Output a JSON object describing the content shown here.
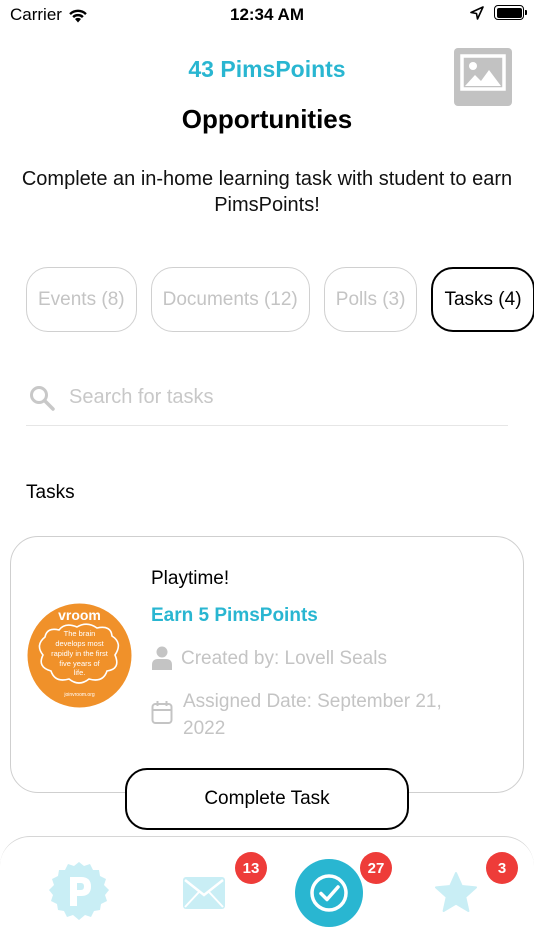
{
  "status_bar": {
    "carrier": "Carrier",
    "time": "12:34 AM",
    "icons": [
      "wifi-icon",
      "location-arrow-icon",
      "battery-icon"
    ]
  },
  "header": {
    "points_label": "43 PimsPoints",
    "title": "Opportunities",
    "description": "Complete an in-home learning task with student to earn PimsPoints!",
    "image_icon": "image-placeholder-icon"
  },
  "tabs": [
    {
      "label": "Events (8)",
      "active": false
    },
    {
      "label": "Documents (12)",
      "active": false
    },
    {
      "label": "Polls (3)",
      "active": false
    },
    {
      "label": "Tasks (4)",
      "active": true
    }
  ],
  "search": {
    "placeholder": "Search for tasks",
    "value": "",
    "icon": "search-icon"
  },
  "section": {
    "title": "Tasks"
  },
  "tasks": [
    {
      "title": "Playtime!",
      "points": "Earn 5 PimsPoints",
      "created_by": "Created by: Lovell Seals",
      "assigned_date": "Assigned Date: September 21, 2022",
      "logo": {
        "brand": "vroom",
        "text": "The brain develops most rapidly in the first five years of life.",
        "url_text": "joinvroom.org",
        "color": "#f0912a"
      },
      "button_label": "Complete Task"
    }
  ],
  "bottom_nav": {
    "items": [
      {
        "name": "home",
        "icon": "pimspoints-p-icon",
        "badge": ""
      },
      {
        "name": "messages",
        "icon": "envelope-icon",
        "badge": "13"
      },
      {
        "name": "tasks",
        "icon": "checkmark-circle-icon",
        "badge": "27",
        "active": true
      },
      {
        "name": "favorites",
        "icon": "star-icon",
        "badge": "3"
      }
    ]
  },
  "colors": {
    "accent": "#29b6d1",
    "accent_light": "#c9eef5",
    "badge": "#ee3c39",
    "muted_text": "#c4c4c4",
    "border": "#d0d0d0"
  }
}
